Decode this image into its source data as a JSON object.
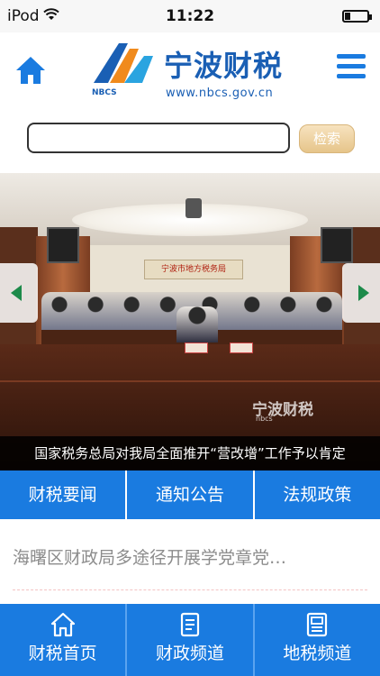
{
  "status_bar": {
    "carrier": "iPod",
    "time": "11:22"
  },
  "header": {
    "logo_title": "宁波财税",
    "logo_abbr": "NBCS",
    "logo_url": "www.nbcs.gov.cn",
    "brand_color": "#1a5fb4",
    "icons": {
      "home": "home-icon",
      "menu": "hamburger-menu-icon"
    }
  },
  "search": {
    "placeholder": "",
    "button_label": "检索"
  },
  "banner": {
    "room_sign": "宁波市地方税务局",
    "watermark": "宁波财税",
    "watermark_sub": "nbcs",
    "caption": "国家税务总局对我局全面推开“营改增”工作予以肯定"
  },
  "tabs": [
    {
      "label": "财税要闻"
    },
    {
      "label": "通知公告"
    },
    {
      "label": "法规政策"
    }
  ],
  "news": [
    {
      "title": "海曙区财政局多途径开展学党章党…"
    }
  ],
  "bottom_nav": [
    {
      "label": "财税首页",
      "icon": "home-icon"
    },
    {
      "label": "财政频道",
      "icon": "document-icon"
    },
    {
      "label": "地税频道",
      "icon": "tax-document-icon"
    }
  ],
  "colors": {
    "accent": "#1a7be0",
    "search_button": "#e6c58a",
    "arrow": "#1d8a4a"
  }
}
